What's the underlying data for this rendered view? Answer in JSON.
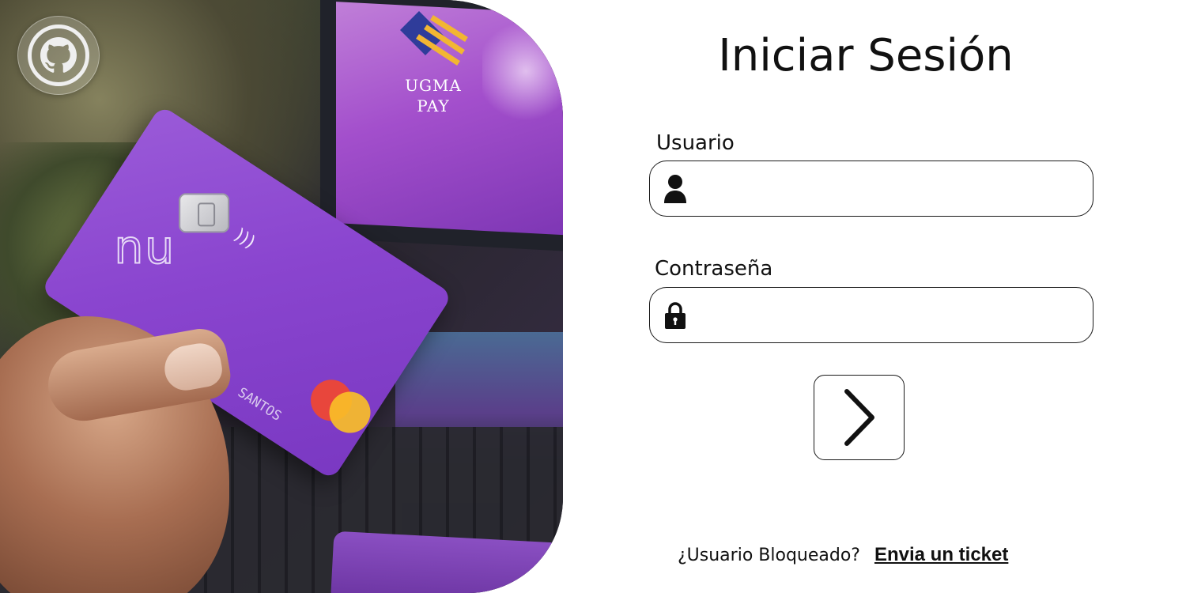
{
  "brand": {
    "line1": "UGMA",
    "line2": "PAY"
  },
  "icons": {
    "github": "github-icon",
    "user": "user-icon",
    "lock": "lock-icon",
    "submit": "chevron-right-icon"
  },
  "photo": {
    "card_holder": "SANTOS",
    "card_logo": "nu"
  },
  "login": {
    "title": "Iniciar Sesión",
    "user_label": "Usuario",
    "user_value": "",
    "password_label": "Contraseña",
    "password_value": ""
  },
  "footer": {
    "question": "¿Usuario Bloqueado?",
    "link": "Envia un ticket"
  },
  "colors": {
    "card_purple": "#8a45cf",
    "text": "#111111",
    "brand_blue": "#2f3c9a",
    "brand_gold": "#f2b632"
  }
}
